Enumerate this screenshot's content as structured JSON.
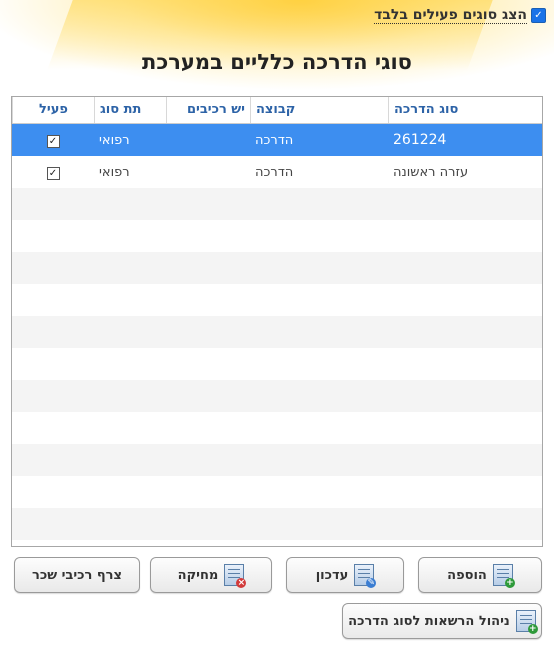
{
  "filter": {
    "label": "הצג סוגים פעילים בלבד",
    "checked_mark": "✓"
  },
  "title": "סוגי הדרכה כלליים במערכת",
  "grid": {
    "columns": [
      "סוג הדרכה",
      "קבוצה",
      "יש רכיבים",
      "תת סוג",
      "פעיל"
    ],
    "rows": [
      {
        "type": "261224",
        "group": "הדרכה",
        "components": "",
        "subtype": "רפואי",
        "active": "✓",
        "selected": true
      },
      {
        "type": "עזרה ראשונה",
        "group": "הדרכה",
        "components": "",
        "subtype": "רפואי",
        "active": "✓",
        "selected": false
      }
    ]
  },
  "buttons": {
    "add": "הוספה",
    "update": "עדכון",
    "delete": "מחיקה",
    "attach": "צרף רכיבי שכר",
    "permissions": "ניהול הרשאות לסוג הדרכה"
  },
  "colors": {
    "selected_row": "#3d8ef0",
    "header_text": "#2d63a7",
    "accent_glow": "#ffc828"
  }
}
